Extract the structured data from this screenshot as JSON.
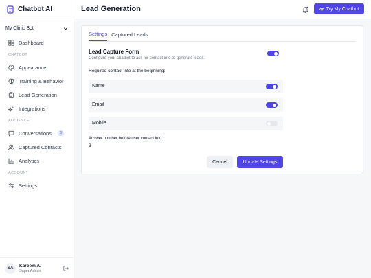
{
  "brand": {
    "name": "Chatbot AI",
    "icon": "bot-logo-icon"
  },
  "bot_select": {
    "value": "My Clinic Bot"
  },
  "nav": {
    "items": [
      {
        "label": "Dashboard",
        "icon": "grid-icon"
      },
      {
        "label": "Appearance",
        "icon": "palette-icon"
      },
      {
        "label": "Training & Behavior",
        "icon": "brain-icon"
      },
      {
        "label": "Lead Generation",
        "icon": "clipboard-icon"
      },
      {
        "label": "Integrations",
        "icon": "sparkle-icon"
      },
      {
        "label": "Conversations",
        "icon": "message-icon",
        "badge": "3"
      },
      {
        "label": "Captured Contacts",
        "icon": "users-icon"
      },
      {
        "label": "Analytics",
        "icon": "chart-icon"
      },
      {
        "label": "Settings",
        "icon": "sliders-icon"
      }
    ],
    "sections": {
      "chatbot": "CHATBOT",
      "audience": "AUDIENCE",
      "account": "ACCOUNT"
    }
  },
  "user": {
    "initials": "SA",
    "name": "Kareem A.",
    "role": "Super Admin"
  },
  "header": {
    "title": "Lead Generation",
    "try_button": "Try My Chatbot"
  },
  "tabs": {
    "settings": "Settings",
    "captured": "Captured Leads",
    "active": "Settings"
  },
  "lead_capture": {
    "title": "Lead Capture Form",
    "description": "Configure your chatbot to ask for contact info to generate leads.",
    "enabled": true
  },
  "required_label": "Required contact info at the beginning:",
  "fields": [
    {
      "name": "Name",
      "enabled": true
    },
    {
      "name": "Email",
      "enabled": true
    },
    {
      "name": "Mobile",
      "enabled": false
    }
  ],
  "answer": {
    "label": "Answer number before user contact info:",
    "value": "3"
  },
  "buttons": {
    "cancel": "Cancel",
    "update": "Update Settings"
  },
  "colors": {
    "accent": "#4f46e5",
    "toggle_off": "#e5e7eb"
  }
}
